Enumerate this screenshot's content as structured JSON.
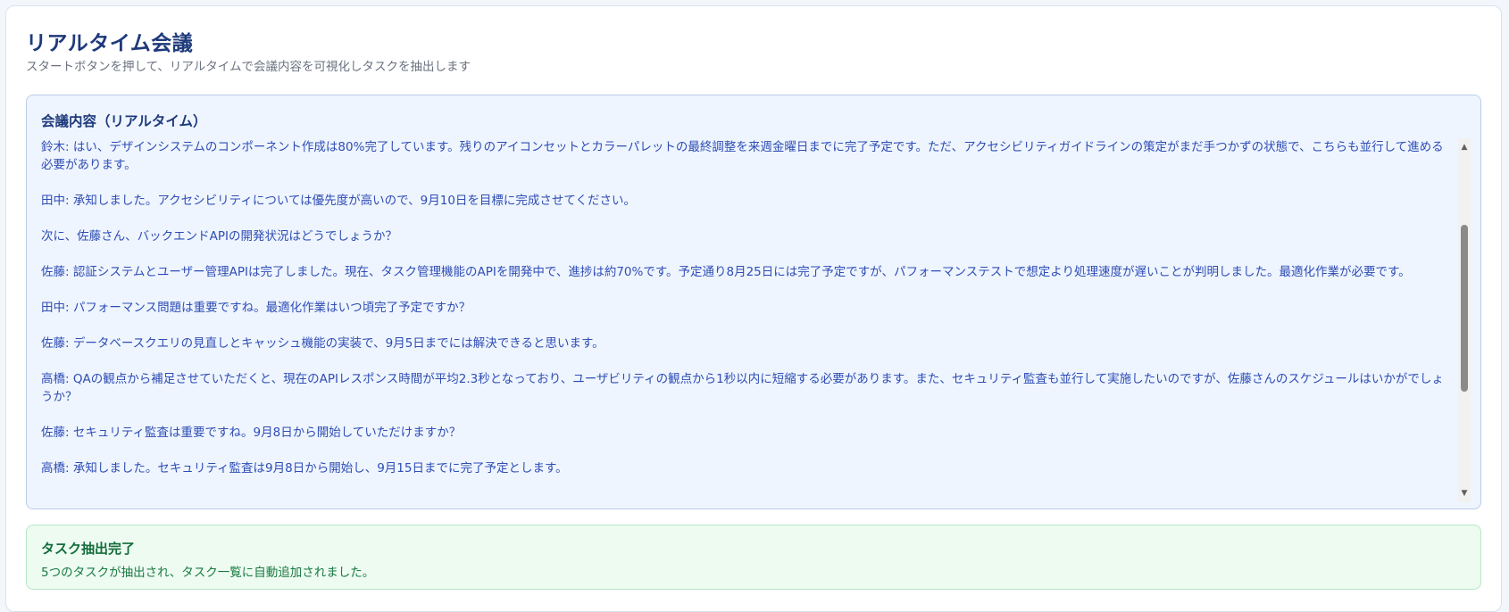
{
  "header": {
    "title": "リアルタイム会議",
    "subtitle": "スタートボタンを押して、リアルタイムで会議内容を可視化しタスクを抽出します"
  },
  "transcript": {
    "heading": "会議内容（リアルタイム）",
    "lines": [
      "鈴木: はい、デザインシステムのコンポーネント作成は80%完了しています。残りのアイコンセットとカラーパレットの最終調整を来週金曜日までに完了予定です。ただ、アクセシビリティガイドラインの策定がまだ手つかずの状態で、こちらも並行して進める必要があります。",
      "田中: 承知しました。アクセシビリティについては優先度が高いので、9月10日を目標に完成させてください。",
      "次に、佐藤さん、バックエンドAPIの開発状況はどうでしょうか？",
      "佐藤: 認証システムとユーザー管理APIは完了しました。現在、タスク管理機能のAPIを開発中で、進捗は約70%です。予定通り8月25日には完了予定ですが、パフォーマンステストで想定より処理速度が遅いことが判明しました。最適化作業が必要です。",
      "田中: パフォーマンス問題は重要ですね。最適化作業はいつ頃完了予定ですか？",
      "佐藤: データベースクエリの見直しとキャッシュ機能の実装で、9月5日までには解決できると思います。",
      "高橋: QAの観点から補足させていただくと、現在のAPIレスポンス時間が平均2.3秒となっており、ユーザビリティの観点から1秒以内に短縮する必要があります。また、セキュリティ監査も並行して実施したいのですが、佐藤さんのスケジュールはいかがでしょうか？",
      "佐藤: セキュリティ監査は重要ですね。9月8日から開始していただけますか？",
      "高橋: 承知しました。セキュリティ監査は9月8日から開始し、9月15日までに完了予定とします。"
    ]
  },
  "status": {
    "title": "タスク抽出完了",
    "message": "5つのタスクが抽出され、タスク一覧に自動追加されました。"
  },
  "icons": {
    "scroll_up": "scroll-up-arrow-icon",
    "scroll_down": "scroll-down-arrow-icon"
  },
  "colors": {
    "title": "#1e3a7b",
    "transcript_text": "#2f4db4",
    "transcript_bg": "#eef5ff",
    "status_bg": "#edfbf1",
    "status_text": "#146c3b"
  }
}
